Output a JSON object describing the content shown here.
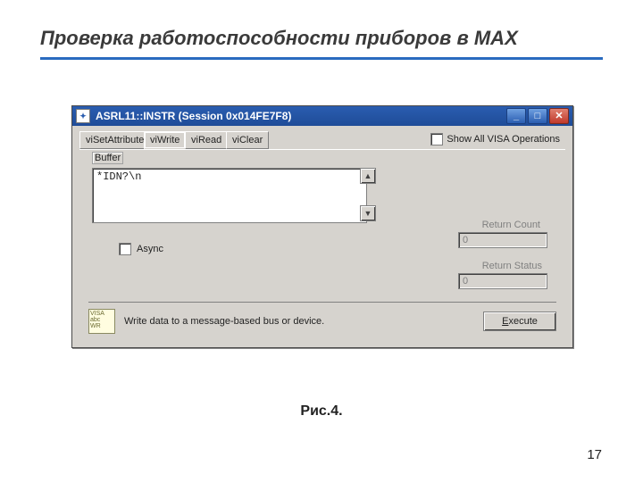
{
  "slide": {
    "title": "Проверка работоспособности  приборов в MAX",
    "figure_label": "Рис.4.",
    "page_number": "17"
  },
  "window": {
    "title": "ASRL11::INSTR (Session 0x014FE7F8)",
    "tabs": [
      "viSetAttribute",
      "viWrite",
      "viRead",
      "viClear"
    ],
    "active_tab_index": 1,
    "show_all_label": "Show All VISA Operations",
    "buffer_label": "Buffer",
    "buffer_value": "*IDN?\\n",
    "async_label": "Async",
    "return_count_label": "Return Count",
    "return_count_value": "0",
    "return_status_label": "Return Status",
    "return_status_value": "0",
    "hint_text": "Write data to a message-based bus or device.",
    "execute_label": "Execute",
    "hint_icon_lines": [
      "VISA",
      "abc",
      "WR"
    ]
  }
}
